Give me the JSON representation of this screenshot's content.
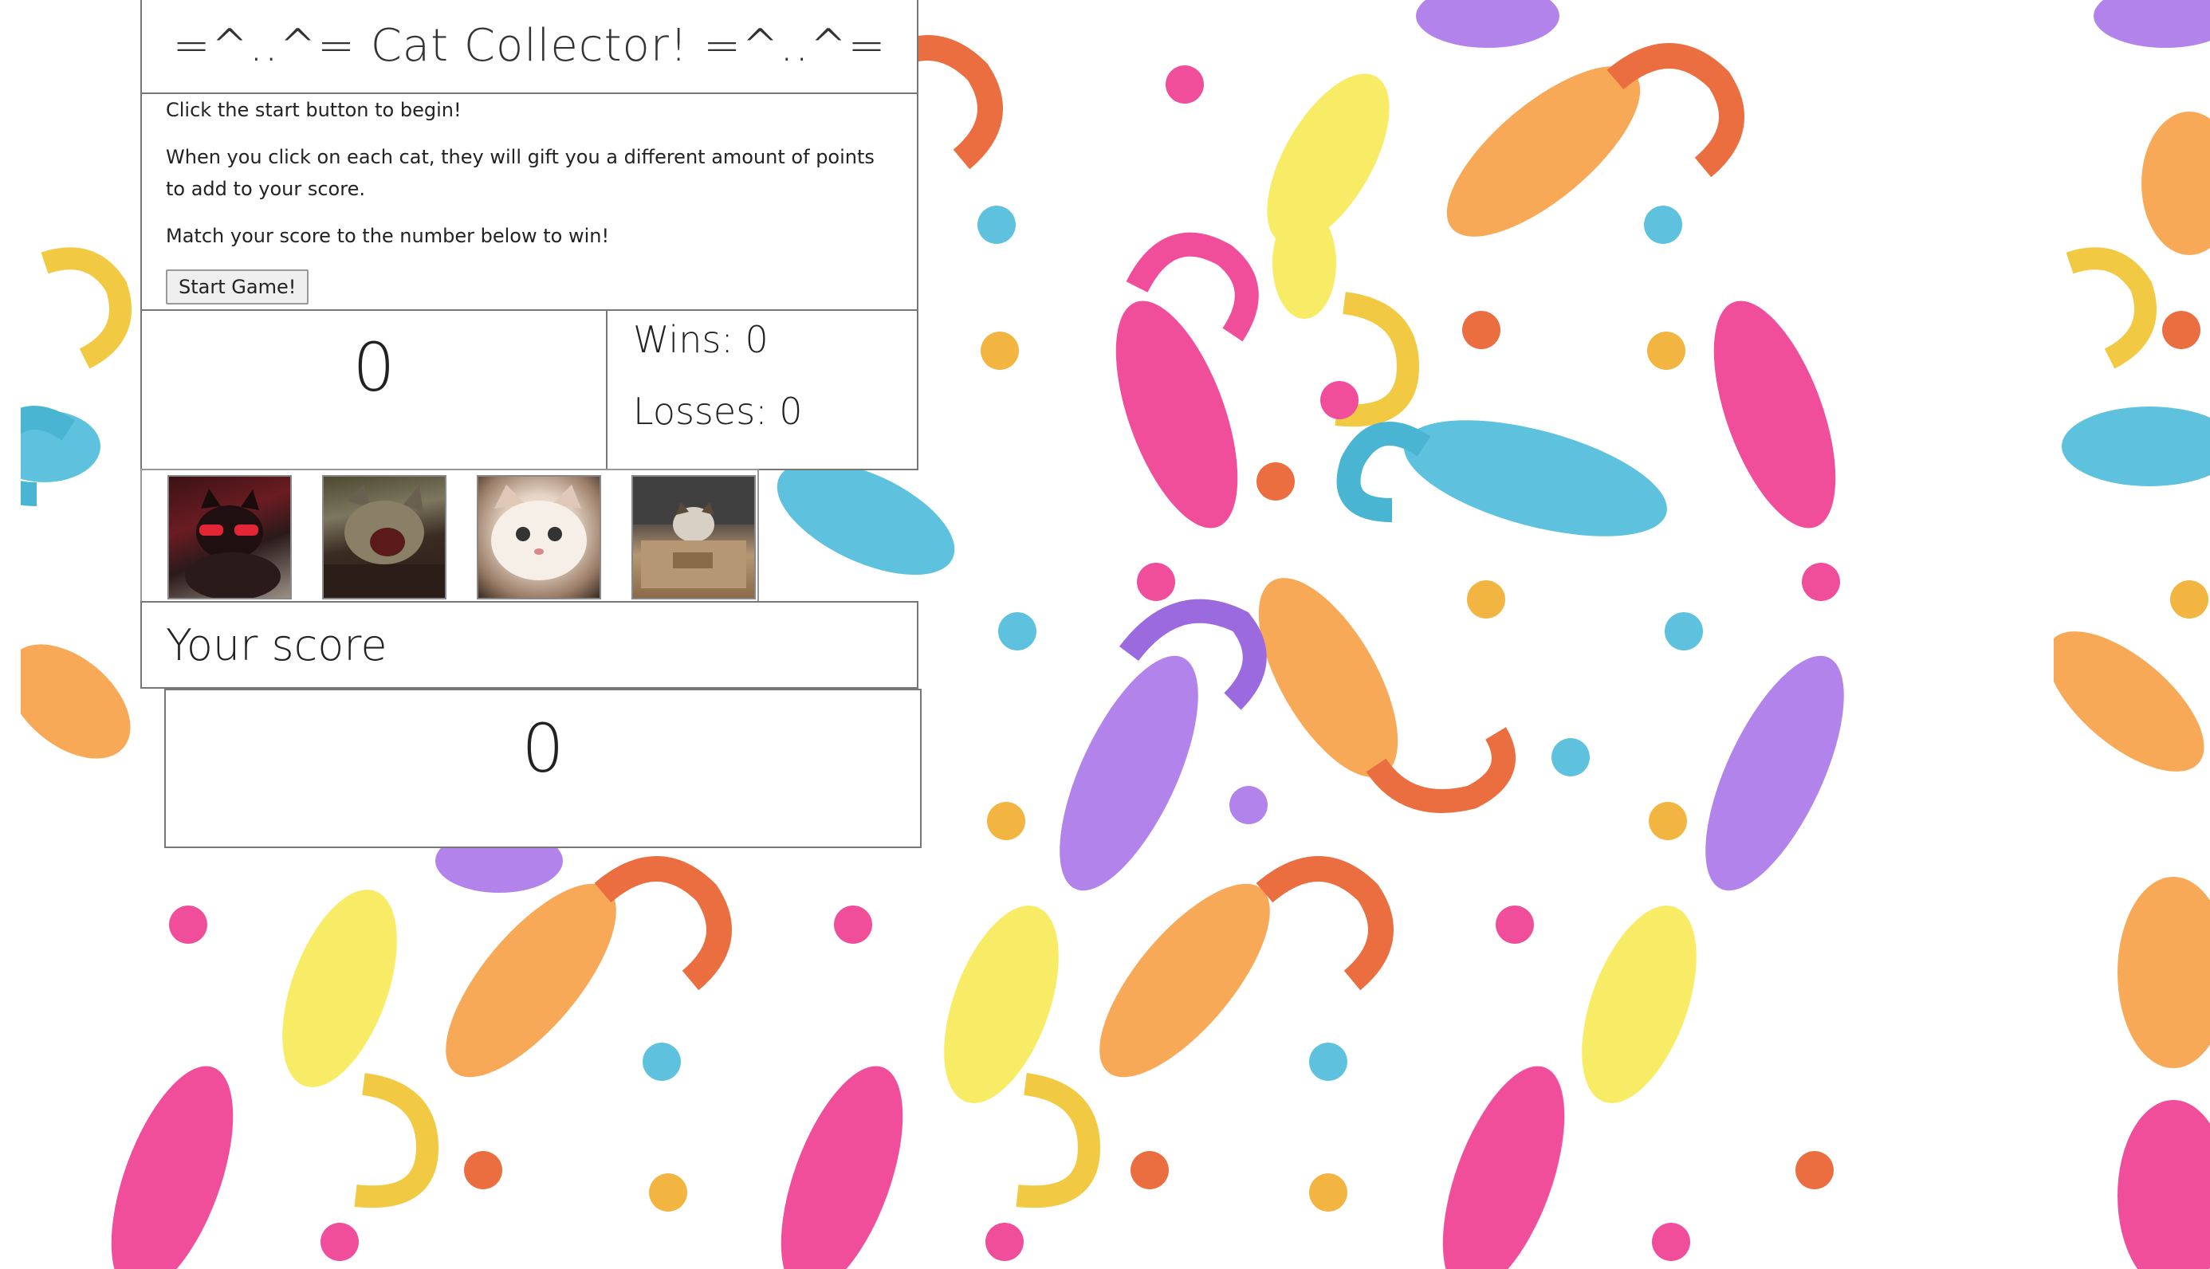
{
  "header": {
    "title": "=^..^= Cat Collector! =^..^="
  },
  "instructions": {
    "line1": "Click the start button to begin!",
    "line2": "When you click on each cat, they will gift you a different amount of points to add to your score.",
    "line3": "Match your score to the number below to win!",
    "start_button": "Start Game!"
  },
  "target": {
    "value": "0"
  },
  "record": {
    "wins": "Wins: 0",
    "losses": "Losses: 0"
  },
  "cats": [
    {
      "icon": "cat-photo-red-glasses"
    },
    {
      "icon": "cat-photo-yawning"
    },
    {
      "icon": "cat-photo-white"
    },
    {
      "icon": "cat-photo-in-box"
    }
  ],
  "score": {
    "label": "Your score",
    "value": "0"
  },
  "background": {
    "pattern": "watercolor-cats-with-yarn",
    "colors": [
      "#f7e84a",
      "#f79a3a",
      "#ee2e8a",
      "#41b8d8",
      "#a46ee8",
      "#e7541e"
    ]
  }
}
